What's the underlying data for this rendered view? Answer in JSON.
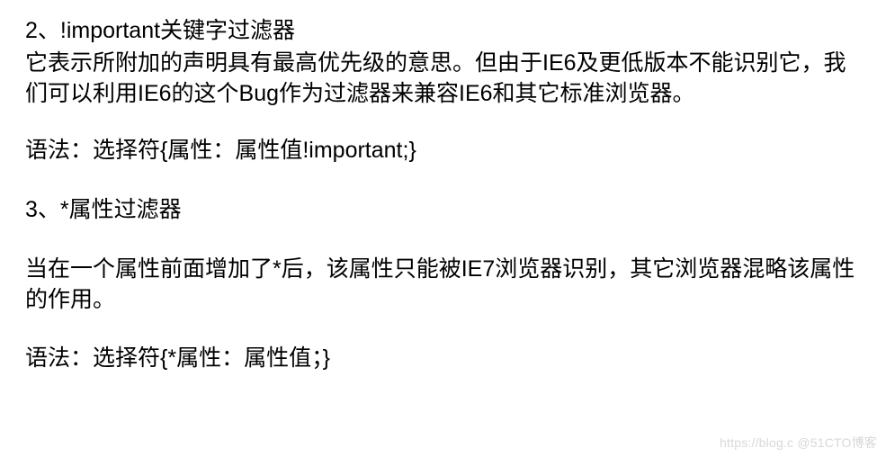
{
  "section2": {
    "title": "2、!important关键字过滤器",
    "paragraph": "它表示所附加的声明具有最高优先级的意思。但由于IE6及更低版本不能识别它，我们可以利用IE6的这个Bug作为过滤器来兼容IE6和其它标准浏览器。",
    "syntax": "语法：选择符{属性：属性值!important;}"
  },
  "section3": {
    "title": "3、*属性过滤器",
    "paragraph": "当在一个属性前面增加了*后，该属性只能被IE7浏览器识别，其它浏览器混略该属性的作用。",
    "syntax": "语法：选择符{*属性：属性值；}"
  },
  "watermark": "https://blog.c   @51CTO博客"
}
